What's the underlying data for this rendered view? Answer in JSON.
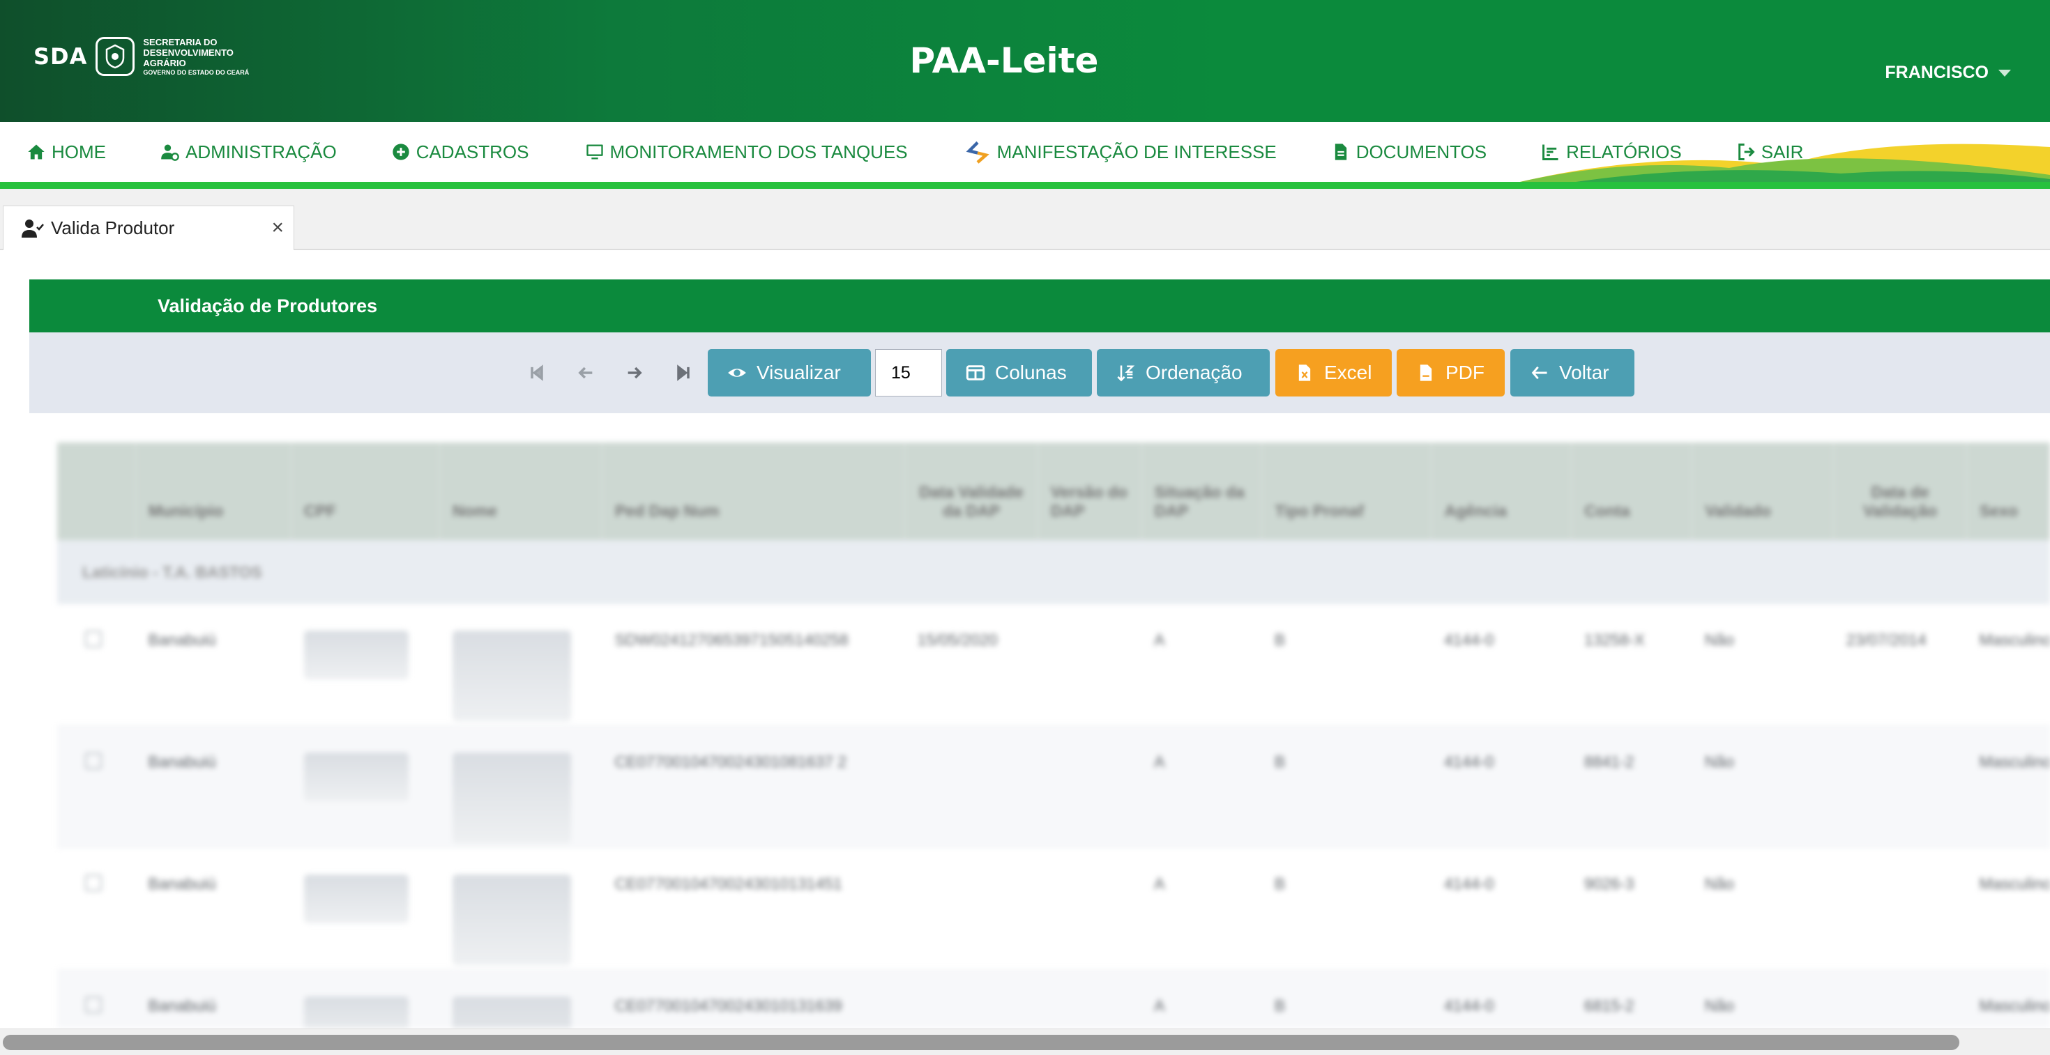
{
  "header": {
    "logo_text": "SDA",
    "secretaria_line1": "SECRETARIA DO",
    "secretaria_line2": "DESENVOLVIMENTO",
    "secretaria_line3": "AGRÁRIO",
    "governo": "GOVERNO DO ESTADO DO CEARÁ",
    "app_title": "PAA-Leite",
    "user": "FRANCISCO"
  },
  "nav": {
    "items": [
      {
        "label": "HOME",
        "icon": "home-icon"
      },
      {
        "label": "ADMINISTRAÇÃO",
        "icon": "user-gear-icon"
      },
      {
        "label": "CADASTROS",
        "icon": "plus-circle-icon"
      },
      {
        "label": "MONITORAMENTO DOS TANQUES",
        "icon": "monitor-icon"
      },
      {
        "label": "MANIFESTAÇÃO DE INTERESSE",
        "icon": "code-arrows-icon"
      },
      {
        "label": "DOCUMENTOS",
        "icon": "document-icon"
      },
      {
        "label": "RELATÓRIOS",
        "icon": "chart-icon"
      },
      {
        "label": "SAIR",
        "icon": "sign-out-icon"
      }
    ]
  },
  "tab": {
    "label": "Valida Produtor",
    "close": "×"
  },
  "panel": {
    "title": "Validação de Produtores"
  },
  "toolbar": {
    "visualizar": "Visualizar",
    "rows": "15",
    "colunas": "Colunas",
    "ordenacao": "Ordenação",
    "excel": "Excel",
    "pdf": "PDF",
    "voltar": "Voltar"
  },
  "table": {
    "columns": [
      "Município",
      "CPF",
      "Nome",
      "Ped Dap Num",
      "Data Validade da DAP",
      "Versão do DAP",
      "Situação da DAP",
      "Tipo Pronaf",
      "Agência",
      "Conta",
      "Validado",
      "Data de Validação",
      "Sexo"
    ],
    "group": "Laticínio - T.A. BASTOS",
    "rows": [
      [
        "Banabuiú",
        "",
        "",
        "SDW0241270653971505140258",
        "15/05/2020",
        "",
        "A",
        "B",
        "4144-0",
        "13258-X",
        "Não",
        "23/07/2014",
        "Masculino"
      ],
      [
        "Banabuiú",
        "",
        "",
        "CE0770010470024301081637 2",
        "",
        "",
        "A",
        "B",
        "4144-0",
        "8841-2",
        "Não",
        "",
        "Masculino"
      ],
      [
        "Banabuiú",
        "",
        "",
        "CE07700104700243010131451",
        "",
        "",
        "A",
        "B",
        "4144-0",
        "9026-3",
        "Não",
        "",
        "Masculino"
      ],
      [
        "Banabuiú",
        "",
        "",
        "CE07700104700243010131639",
        "",
        "",
        "A",
        "B",
        "4144-0",
        "6815-2",
        "Não",
        "",
        "Masculino"
      ]
    ]
  }
}
